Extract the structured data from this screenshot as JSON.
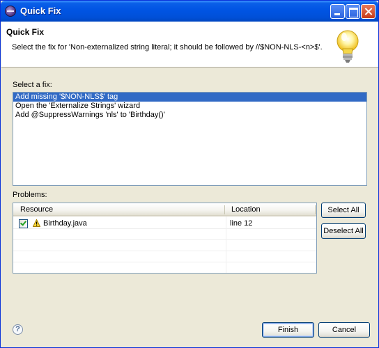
{
  "window": {
    "title": "Quick Fix"
  },
  "header": {
    "title": "Quick Fix",
    "message": "Select the fix for 'Non-externalized string literal; it should be followed by //$NON-NLS-<n>$'."
  },
  "fixes": {
    "label": "Select a fix:",
    "items": [
      {
        "label": "Add missing '$NON-NLS$' tag",
        "selected": true
      },
      {
        "label": "Open the 'Externalize Strings' wizard",
        "selected": false
      },
      {
        "label": "Add @SuppressWarnings 'nls' to 'Birthday()'",
        "selected": false
      }
    ]
  },
  "problems": {
    "label": "Problems:",
    "columns": [
      "Resource",
      "Location"
    ],
    "rows": [
      {
        "checked": true,
        "resource": "Birthday.java",
        "location": "line 12"
      }
    ]
  },
  "buttons": {
    "select_all": "Select All",
    "deselect_all": "Deselect All",
    "finish": "Finish",
    "cancel": "Cancel",
    "help": "?"
  },
  "colors": {
    "selection": "#316ac5",
    "titlebar": "#0054e3",
    "dialog_bg": "#ece9d8"
  }
}
